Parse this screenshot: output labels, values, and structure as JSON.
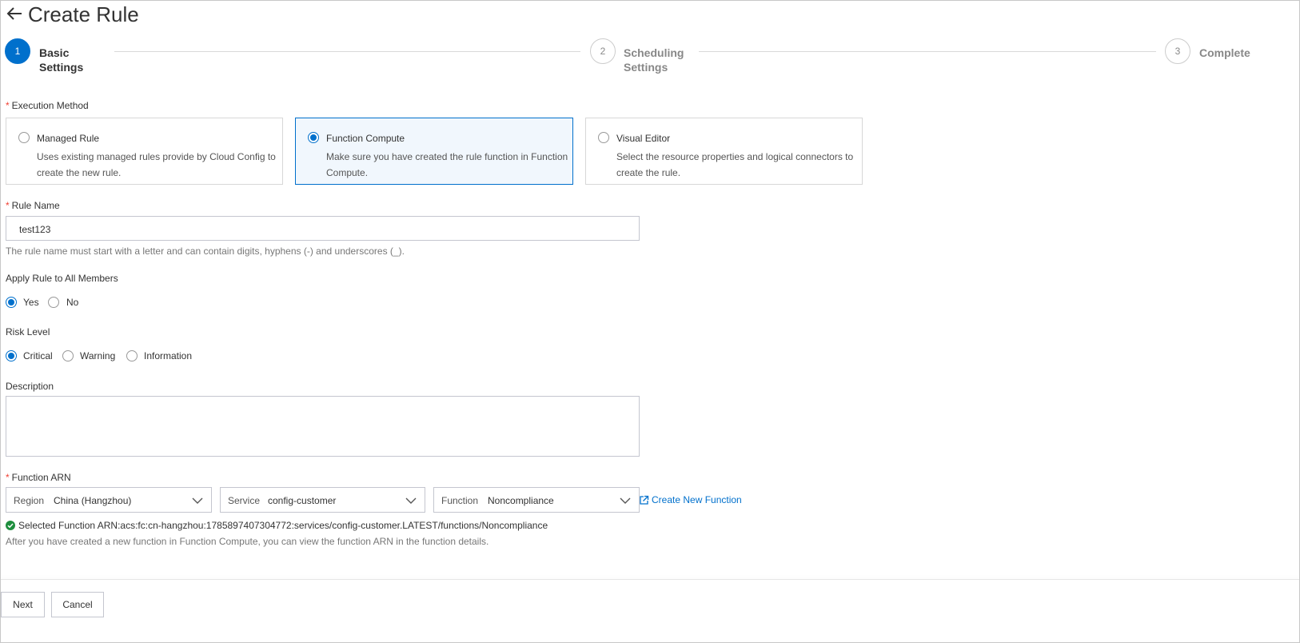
{
  "header": {
    "title": "Create Rule",
    "back_icon": "arrow-left-icon"
  },
  "steps": [
    {
      "number": "1",
      "label_line1": "Basic",
      "label_line2": "Settings",
      "state": "active"
    },
    {
      "number": "2",
      "label_line1": "Scheduling",
      "label_line2": "Settings",
      "state": "idle"
    },
    {
      "number": "3",
      "label_line1": "Complete",
      "label_line2": "",
      "state": "idle"
    }
  ],
  "execution_method": {
    "label": "Execution Method",
    "required_mark": "*",
    "options": [
      {
        "title": "Managed Rule",
        "desc": "Uses existing managed rules provide by Cloud Config to create the new rule.",
        "selected": false
      },
      {
        "title": "Function Compute",
        "desc": "Make sure you have created the rule function in Function Compute.",
        "selected": true
      },
      {
        "title": "Visual Editor",
        "desc": "Select the resource properties and logical connectors to create the rule.",
        "selected": false
      }
    ]
  },
  "rule_name": {
    "label": "Rule Name",
    "required_mark": "*",
    "value": "test123",
    "help": "The rule name must start with a letter and can contain digits, hyphens (-) and underscores (_)."
  },
  "apply_all": {
    "label": "Apply Rule to All Members",
    "options": [
      {
        "label": "Yes",
        "selected": true
      },
      {
        "label": "No",
        "selected": false
      }
    ]
  },
  "risk_level": {
    "label": "Risk Level",
    "options": [
      {
        "label": "Critical",
        "selected": true
      },
      {
        "label": "Warning",
        "selected": false
      },
      {
        "label": "Information",
        "selected": false
      }
    ]
  },
  "description": {
    "label": "Description",
    "value": ""
  },
  "function_arn": {
    "label": "Function ARN",
    "required_mark": "*",
    "region": {
      "label": "Region",
      "value": "China (Hangzhou)"
    },
    "service": {
      "label": "Service",
      "value": "config-customer"
    },
    "function": {
      "label": "Function",
      "value": "Noncompliance"
    },
    "create_link": "Create New Function",
    "selected_text": "Selected Function ARN:acs:fc:cn-hangzhou:1785897407304772:services/config-customer.LATEST/functions/Noncompliance",
    "help": "After you have created a new function in Function Compute, you can view the function ARN in the function details."
  },
  "footer": {
    "next": "Next",
    "cancel": "Cancel"
  },
  "colors": {
    "accent": "#0070cc",
    "success": "#1e8e3e",
    "required": "#f04134"
  }
}
